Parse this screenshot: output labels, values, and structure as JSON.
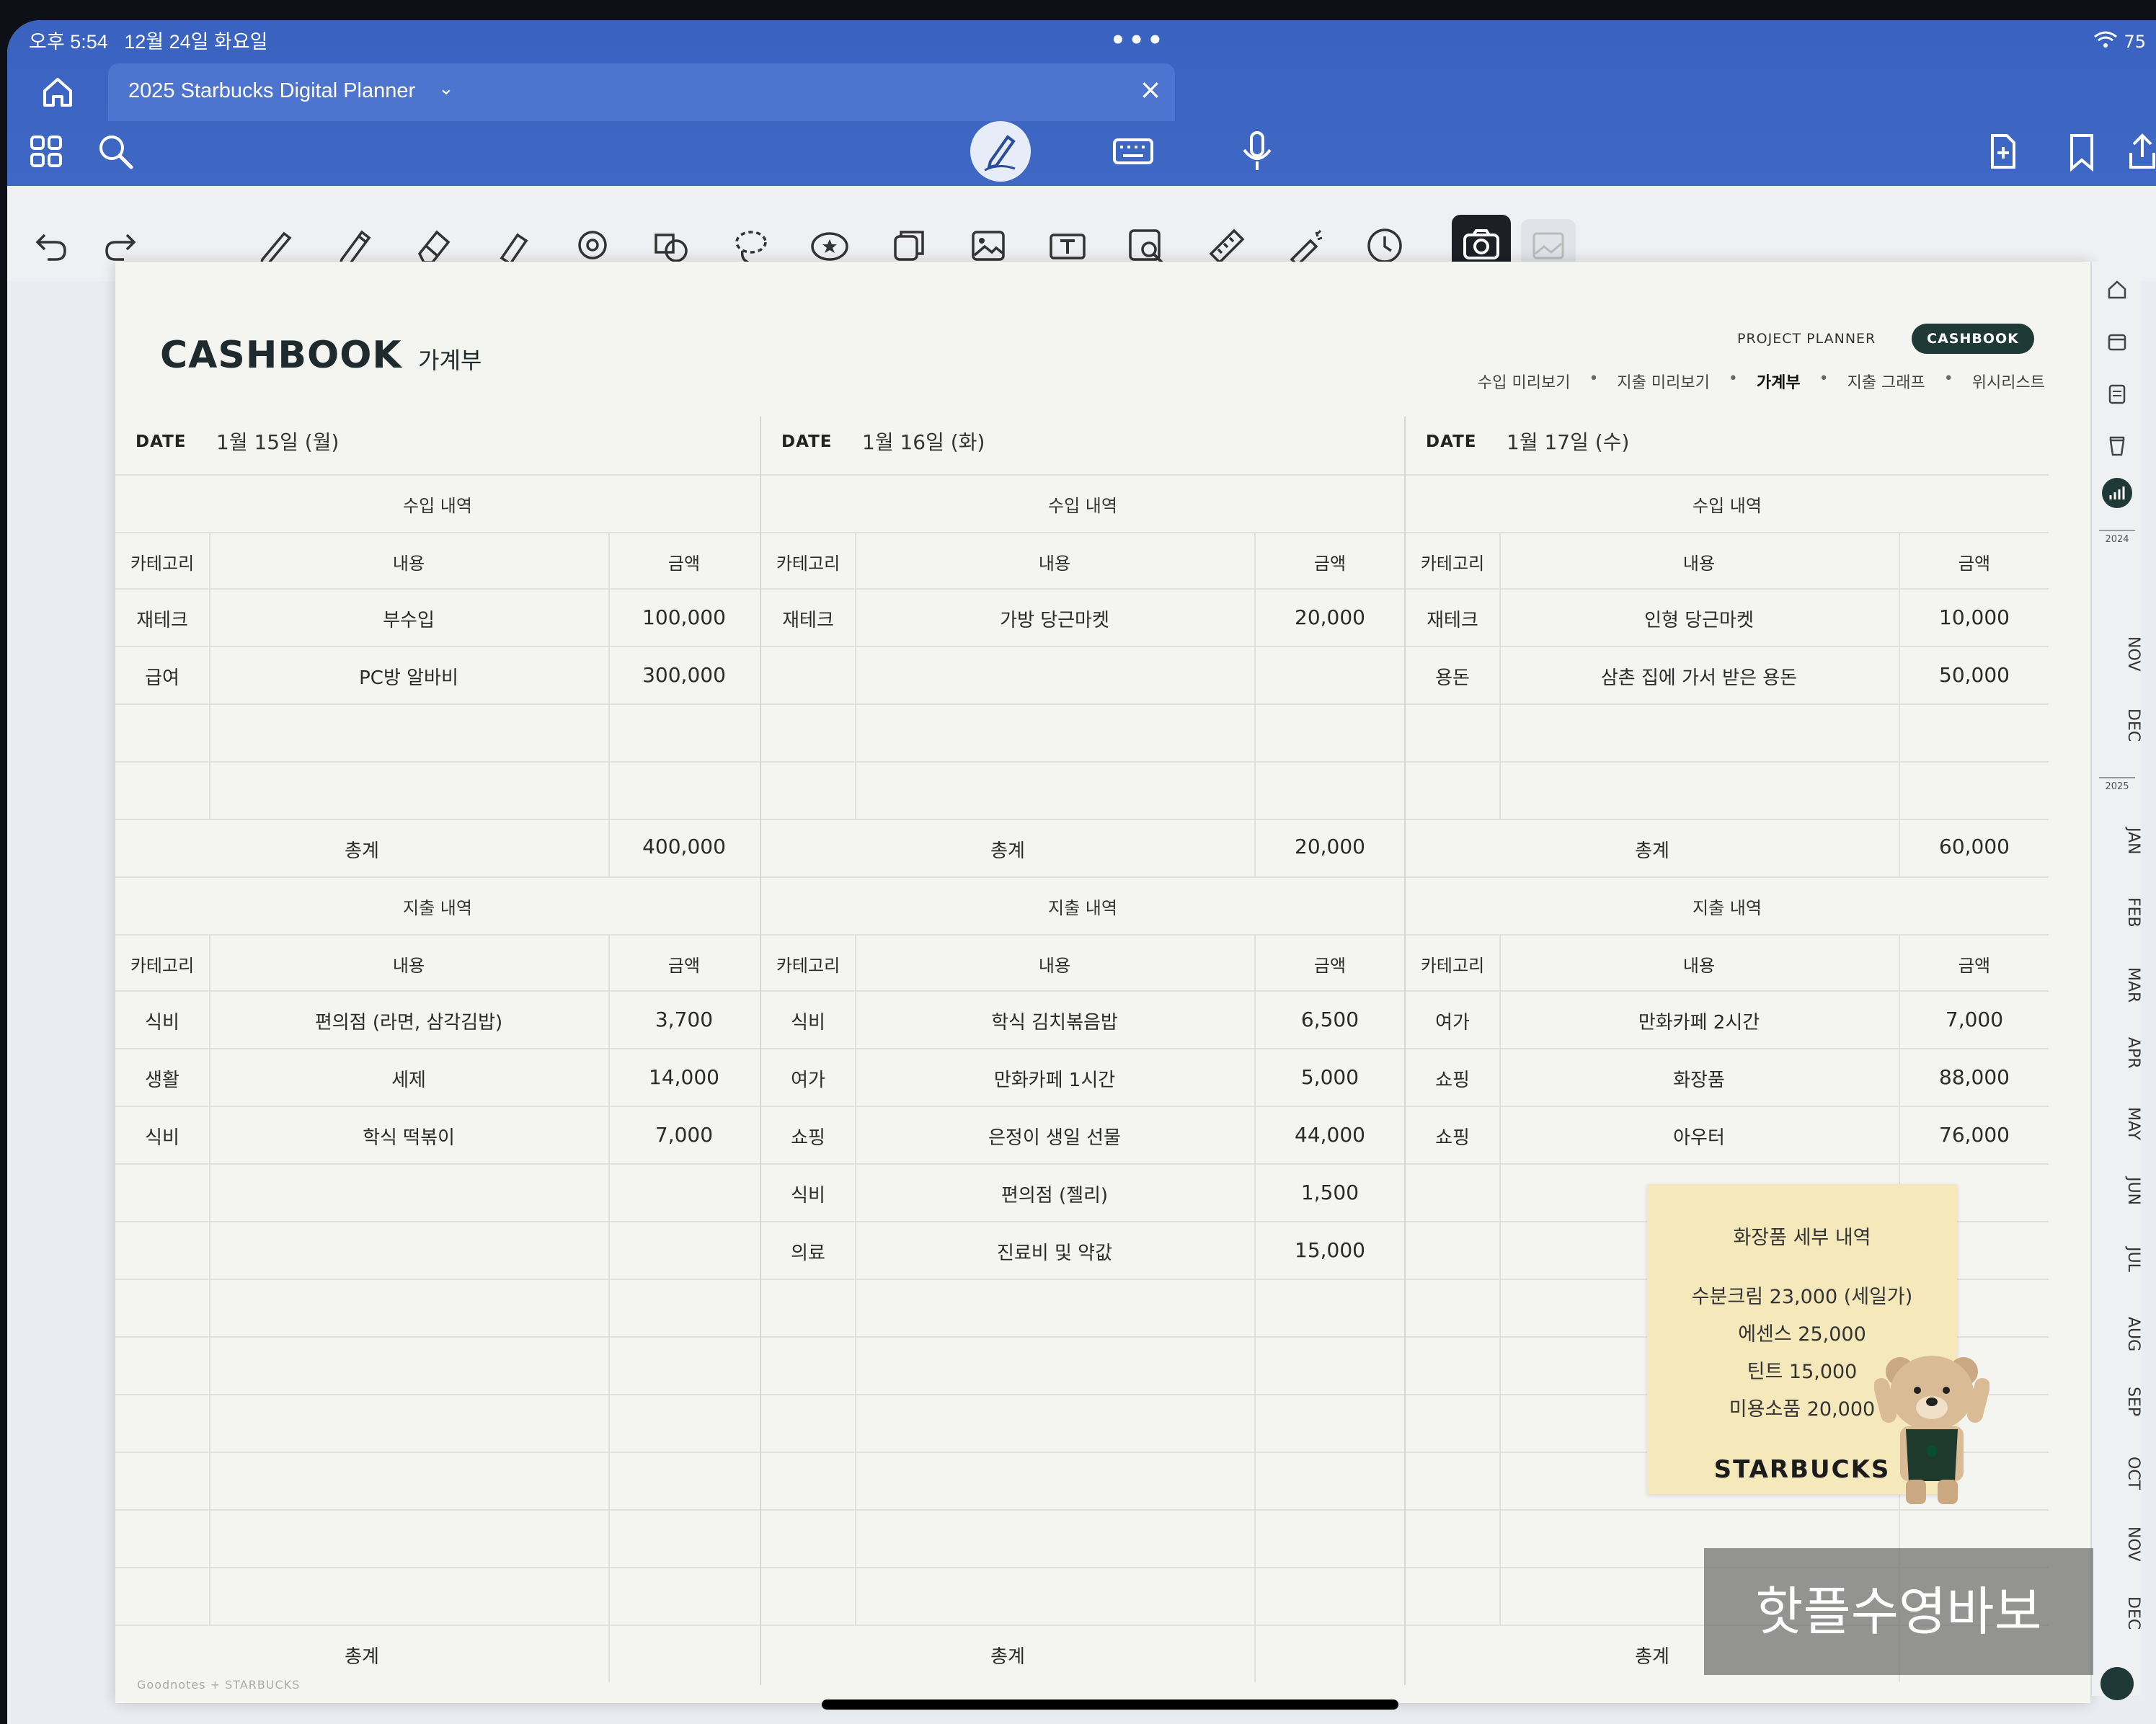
{
  "status_bar": {
    "time": "오후 5:54",
    "date": "12월 24일 화요일",
    "battery": "75"
  },
  "tab": {
    "title": "2025 Starbucks Digital Planner"
  },
  "header": {
    "title": "CASHBOOK",
    "subtitle": "가계부",
    "project_planner": "PROJECT PLANNER",
    "cashbook_pill": "CASHBOOK",
    "subnav": [
      "수입 미리보기",
      "지출 미리보기",
      "가계부",
      "지출 그래프",
      "위시리스트"
    ]
  },
  "labels": {
    "date": "DATE",
    "income": "수입 내역",
    "expense": "지출 내역",
    "category": "카테고리",
    "content": "내용",
    "amount": "금액",
    "total": "총계"
  },
  "days": [
    {
      "date": "1월 15일 (월)",
      "income": [
        [
          "재테크",
          "부수입",
          "100,000"
        ],
        [
          "급여",
          "PC방 알바비",
          "300,000"
        ]
      ],
      "income_total": "400,000",
      "expense": [
        [
          "식비",
          "편의점 (라면, 삼각김밥)",
          "3,700"
        ],
        [
          "생활",
          "세제",
          "14,000"
        ],
        [
          "식비",
          "학식 떡볶이",
          "7,000"
        ]
      ],
      "expense_total": ""
    },
    {
      "date": "1월 16일 (화)",
      "income": [
        [
          "재테크",
          "가방 당근마켓",
          "20,000"
        ]
      ],
      "income_total": "20,000",
      "expense": [
        [
          "식비",
          "학식 김치볶음밥",
          "6,500"
        ],
        [
          "여가",
          "만화카페 1시간",
          "5,000"
        ],
        [
          "쇼핑",
          "은정이 생일 선물",
          "44,000"
        ],
        [
          "식비",
          "편의점 (젤리)",
          "1,500"
        ],
        [
          "의료",
          "진료비 및 약값",
          "15,000"
        ]
      ],
      "expense_total": ""
    },
    {
      "date": "1월 17일 (수)",
      "income": [
        [
          "재테크",
          "인형 당근마켓",
          "10,000"
        ],
        [
          "용돈",
          "삼촌 집에 가서 받은 용돈",
          "50,000"
        ]
      ],
      "income_total": "60,000",
      "expense": [
        [
          "여가",
          "만화카페 2시간",
          "7,000"
        ],
        [
          "쇼핑",
          "화장품",
          "88,000"
        ],
        [
          "쇼핑",
          "아우터",
          "76,000"
        ]
      ],
      "expense_total": ""
    }
  ],
  "sticky_note": {
    "title": "화장품 세부 내역",
    "lines": [
      "수분크림 23,000 (세일가)",
      "에센스 25,000",
      "틴트 15,000",
      "미용소품 20,000"
    ],
    "logo": "STARBUCKS"
  },
  "side_tabs": {
    "year_2024": "2024",
    "months_2024": [
      "NOV",
      "DEC"
    ],
    "year_2025": "2025",
    "months_2025": [
      "JAN",
      "FEB",
      "MAR",
      "APR",
      "MAY",
      "JUN",
      "JUL",
      "AUG",
      "SEP",
      "OCT",
      "NOV",
      "DEC"
    ]
  },
  "footer": "Goodnotes + STARBUCKS",
  "watermark": "핫플수영바보",
  "colors": {
    "chrome_blue": "#3f67c4",
    "pill_green": "#1f3a36",
    "sticky": "#f5e8bb"
  }
}
